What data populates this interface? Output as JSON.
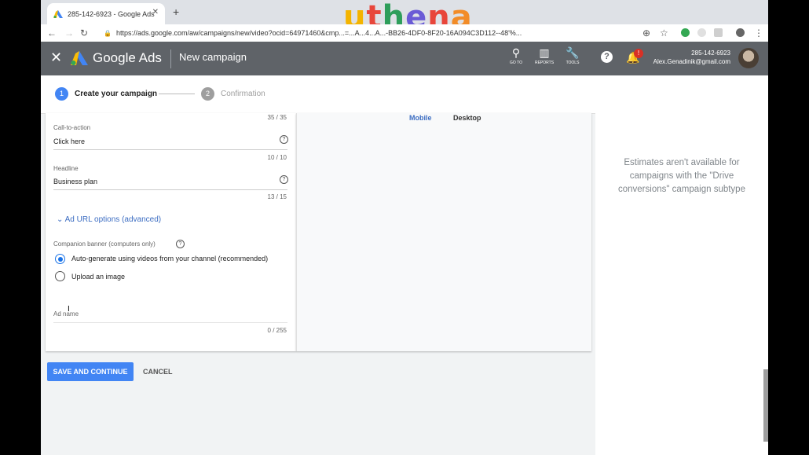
{
  "browser": {
    "tab_title": "285-142-6923 - Google Ads",
    "url": "https://ads.google.com/aw/campaigns/new/video?ocid=64971460&cmp...=...A...4...A...-BB26-4DF0-8F20-16A094C3D112--48'%...",
    "watermark_letters": [
      {
        "ch": "u",
        "color": "#f4b400"
      },
      {
        "ch": "t",
        "color": "#e8463b"
      },
      {
        "ch": "h",
        "color": "#2e9e5b"
      },
      {
        "ch": "e",
        "color": "#6a5bd6"
      },
      {
        "ch": "n",
        "color": "#e8463b"
      },
      {
        "ch": "a",
        "color": "#f28c28"
      }
    ]
  },
  "header": {
    "brand": "Google Ads",
    "page_title": "New campaign",
    "tools": [
      {
        "icon": "search-icon",
        "label": "GO TO"
      },
      {
        "icon": "reports-icon",
        "label": "REPORTS"
      },
      {
        "icon": "wrench-icon",
        "label": "TOOLS"
      }
    ],
    "notification_count": "!",
    "account_id": "285-142-6923",
    "account_email": "Alex.Genadinik@gmail.com"
  },
  "stepper": {
    "steps": [
      {
        "num": "1",
        "label": "Create your campaign",
        "active": true
      },
      {
        "num": "2",
        "label": "Confirmation",
        "active": false
      }
    ]
  },
  "form": {
    "top_counter": "35 / 35",
    "cta_label": "Call-to-action",
    "cta_value": "Click here",
    "cta_counter": "10 / 10",
    "headline_label": "Headline",
    "headline_value": "Business plan",
    "headline_counter": "13 / 15",
    "url_options": "Ad URL options (advanced)",
    "banner_label": "Companion banner (computers only)",
    "banner_options": [
      {
        "label": "Auto-generate using videos from your channel (recommended)",
        "selected": true
      },
      {
        "label": "Upload an image",
        "selected": false
      }
    ],
    "ad_name_label": "Ad name",
    "ad_name_counter": "0 / 255"
  },
  "preview": {
    "tabs": [
      "Mobile",
      "Desktop"
    ]
  },
  "estimates": {
    "message": "Estimates aren't available for campaigns with the \"Drive conversions\" campaign subtype"
  },
  "actions": {
    "save": "SAVE AND CONTINUE",
    "cancel": "CANCEL"
  },
  "colors": {
    "primary": "#4285f4",
    "header_bg": "#5f6368",
    "link": "#3c6dc2"
  }
}
